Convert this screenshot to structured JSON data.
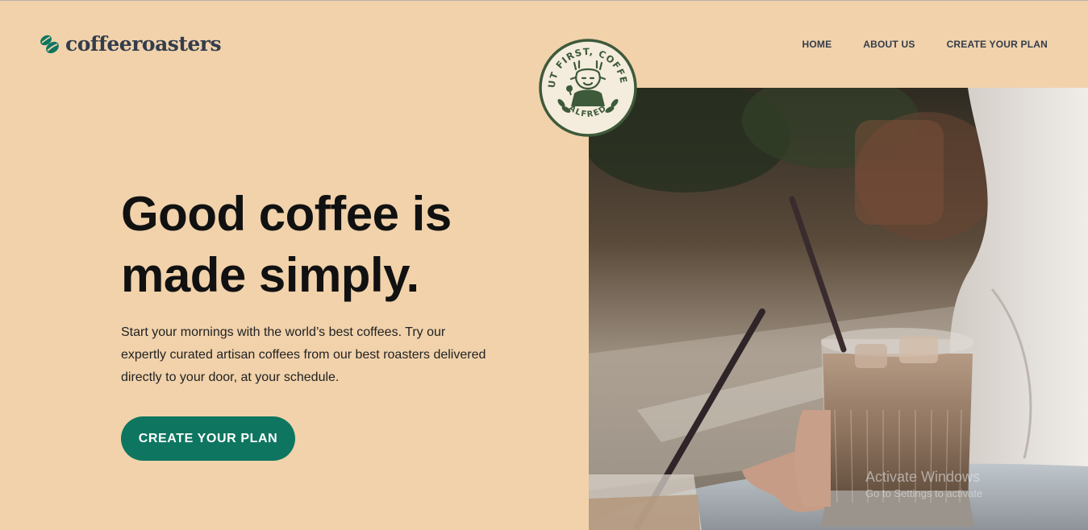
{
  "brand": {
    "name": "coffeeroasters",
    "accent_color": "#0e7660",
    "background_color": "#f1d2ab",
    "logo_icon": "coffee-bean-icon"
  },
  "nav": {
    "items": [
      {
        "label": "HOME"
      },
      {
        "label": "ABOUT US"
      },
      {
        "label": "CREATE YOUR PLAN"
      }
    ]
  },
  "hero": {
    "title_line1": "Good coffee is",
    "title_line2": "made simply.",
    "description_line1": "Start your mornings with the world’s best coffees. Try our",
    "description_line2": "expertly curated artisan coffees from our best roasters delivered",
    "description_line3": "directly to your door, at your schedule.",
    "cta_label": "CREATE YOUR PLAN",
    "image": "iced-coffee-photo"
  },
  "badge": {
    "top_text": "BUT FIRST, COFFEE.",
    "bottom_text": "ALFRED",
    "icon": "alfred-mascot-icon"
  },
  "watermark": {
    "title": "Activate Windows",
    "subtitle": "Go to Settings to activate"
  }
}
